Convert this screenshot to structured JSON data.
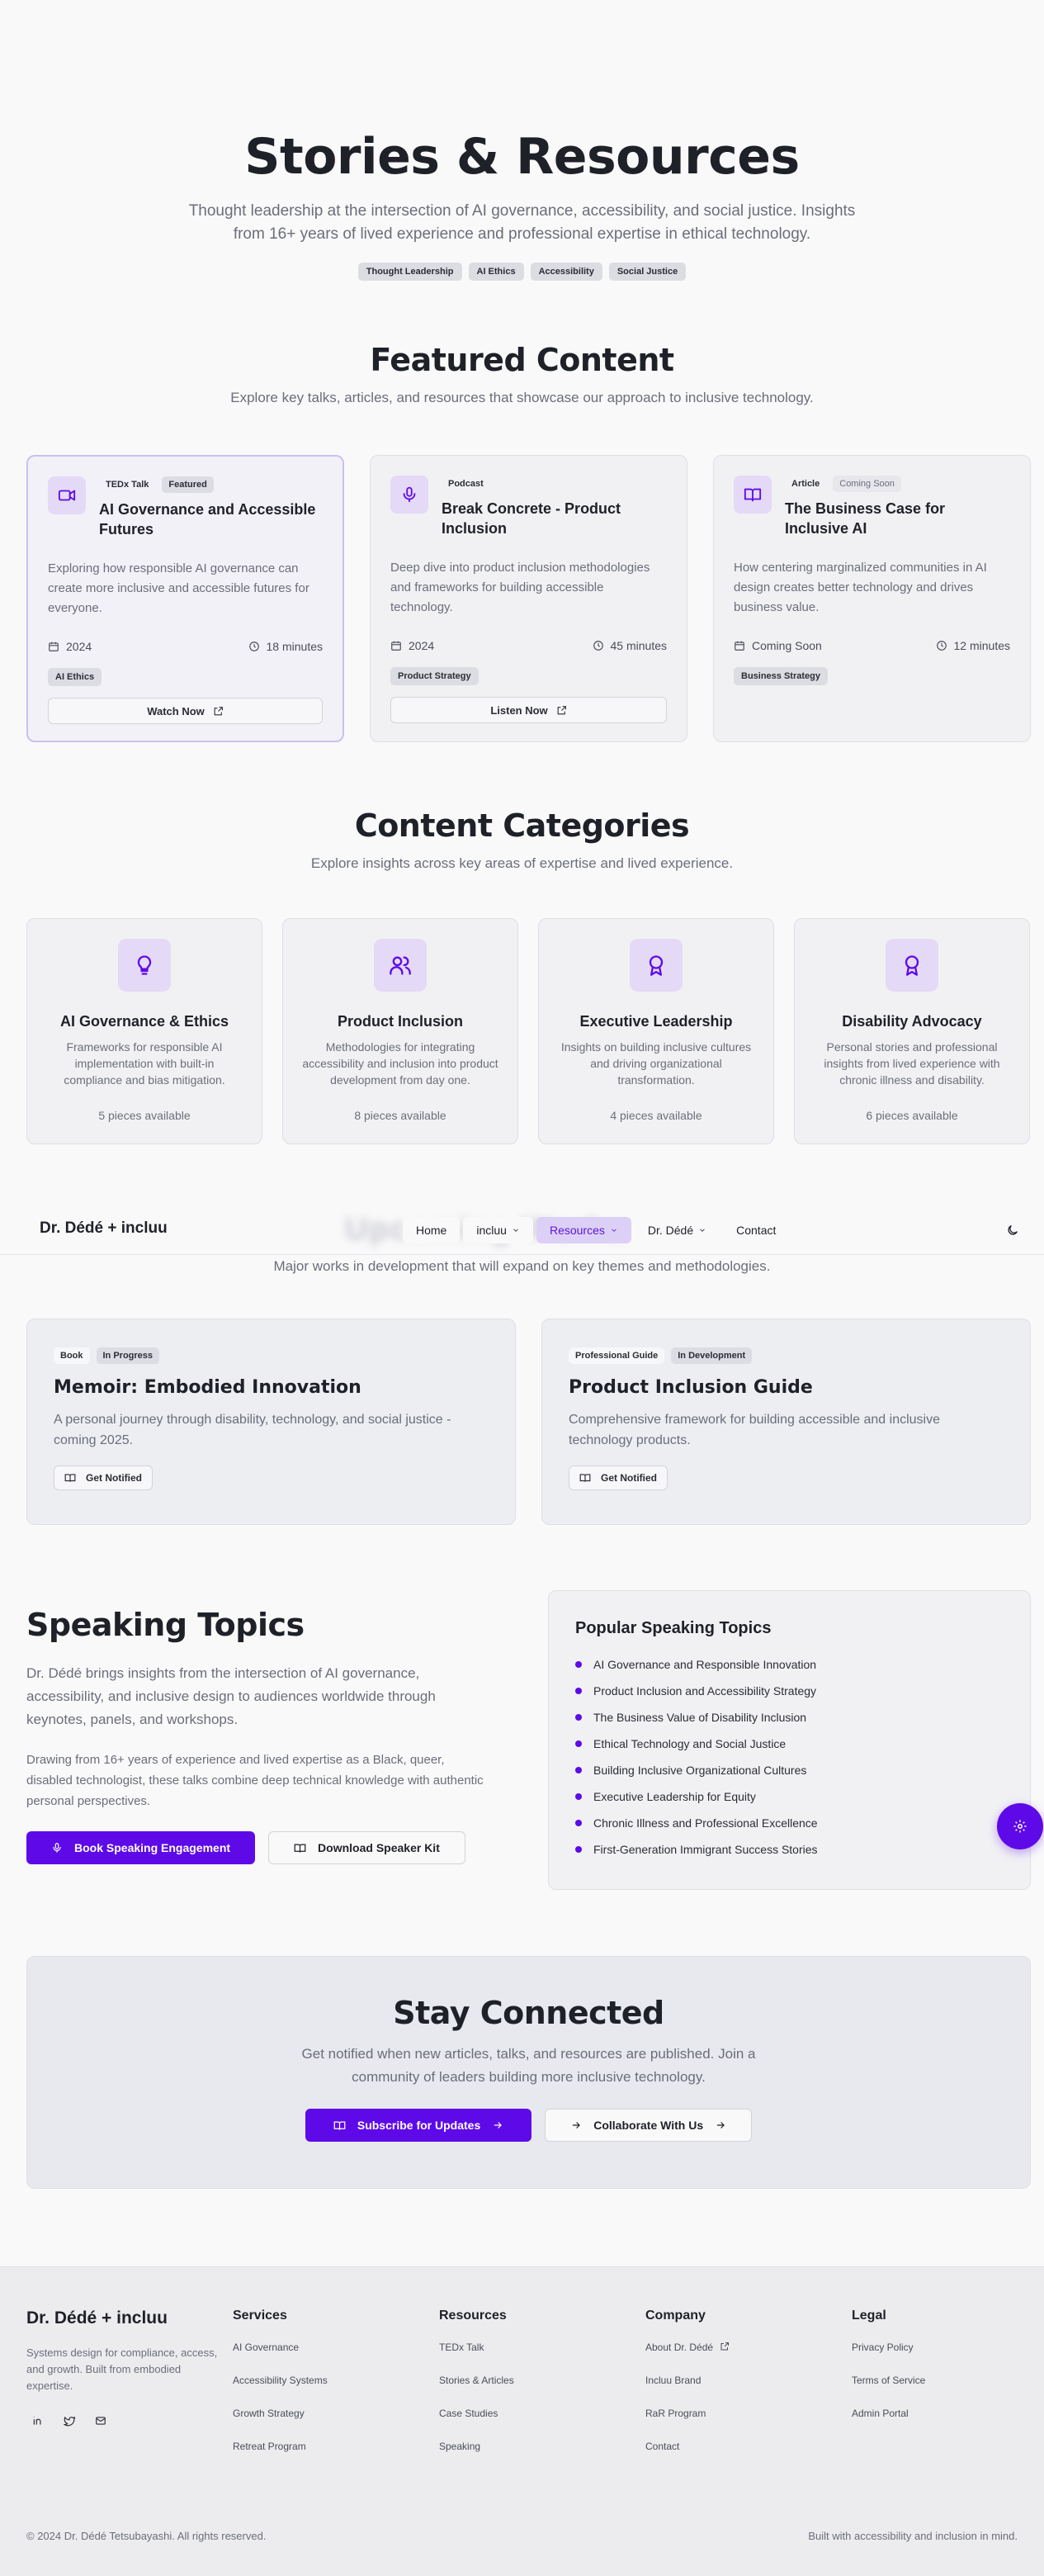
{
  "hero": {
    "title": "Stories & Resources",
    "subtitle": "Thought leadership at the intersection of AI governance, accessibility, and social justice. Insights from 16+ years of lived experience and professional expertise in ethical technology.",
    "tags": [
      "Thought Leadership",
      "AI Ethics",
      "Accessibility",
      "Social Justice"
    ]
  },
  "featured": {
    "title": "Featured Content",
    "subtitle": "Explore key talks, articles, and resources that showcase our approach to inclusive technology.",
    "cards": [
      {
        "icon": "video-icon",
        "type": "TEDx Talk",
        "badge": "Featured",
        "title": "AI Governance and Accessible Futures",
        "desc": "Exploring how responsible AI governance can create more inclusive and accessible futures for everyone.",
        "date": "2024",
        "duration": "18 minutes",
        "tag": "AI Ethics",
        "action": "Watch Now"
      },
      {
        "icon": "microphone-icon",
        "type": "Podcast",
        "badge": "",
        "title": "Break Concrete - Product Inclusion",
        "desc": "Deep dive into product inclusion methodologies and frameworks for building accessible technology.",
        "date": "2024",
        "duration": "45 minutes",
        "tag": "Product Strategy",
        "action": "Listen Now"
      },
      {
        "icon": "book-open-icon",
        "type": "Article",
        "badge": "Coming Soon",
        "title": "The Business Case for Inclusive AI",
        "desc": "How centering marginalized communities in AI design creates better technology and drives business value.",
        "date": "Coming Soon",
        "duration": "12 minutes",
        "tag": "Business Strategy",
        "action": ""
      }
    ]
  },
  "categories": {
    "title": "Content Categories",
    "subtitle": "Explore insights across key areas of expertise and lived experience.",
    "items": [
      {
        "icon": "lightbulb-icon",
        "title": "AI Governance & Ethics",
        "desc": "Frameworks for responsible AI implementation with built-in compliance and bias mitigation.",
        "count": "5 pieces available"
      },
      {
        "icon": "users-icon",
        "title": "Product Inclusion",
        "desc": "Methodologies for integrating accessibility and inclusion into product development from day one.",
        "count": "8 pieces available"
      },
      {
        "icon": "award-icon",
        "title": "Executive Leadership",
        "desc": "Insights on building inclusive cultures and driving organizational transformation.",
        "count": "4 pieces available"
      },
      {
        "icon": "award-icon",
        "title": "Disability Advocacy",
        "desc": "Personal stories and professional insights from lived experience with chronic illness and disability.",
        "count": "6 pieces available"
      }
    ]
  },
  "nav": {
    "brand": "Dr. Dédé + incluu",
    "links": [
      "Home",
      "incluu",
      "Resources",
      "Dr. Dédé",
      "Contact"
    ],
    "active": "Resources"
  },
  "wip": {
    "subtitle": "Major works in development that will expand on key themes and methodologies.",
    "cards": [
      {
        "type": "Book",
        "status": "In Progress",
        "title": "Memoir: Embodied Innovation",
        "desc": "A personal journey through disability, technology, and social justice - coming 2025.",
        "action": "Get Notified"
      },
      {
        "type": "Professional Guide",
        "status": "In Development",
        "title": "Product Inclusion Guide",
        "desc": "Comprehensive framework for building accessible and inclusive technology products.",
        "action": "Get Notified"
      }
    ]
  },
  "speaking": {
    "title": "Speaking Topics",
    "p1": "Dr. Dédé brings insights from the intersection of AI governance, accessibility, and inclusive design to audiences worldwide through keynotes, panels, and workshops.",
    "p2": "Drawing from 16+ years of experience and lived expertise as a Black, queer, disabled technologist, these talks combine deep technical knowledge with authentic personal perspectives.",
    "primary": "Book Speaking Engagement",
    "secondary": "Download Speaker Kit",
    "popular_title": "Popular Speaking Topics",
    "topics": [
      "AI Governance and Responsible Innovation",
      "Product Inclusion and Accessibility Strategy",
      "The Business Value of Disability Inclusion",
      "Ethical Technology and Social Justice",
      "Building Inclusive Organizational Cultures",
      "Executive Leadership for Equity",
      "Chronic Illness and Professional Excellence",
      "First-Generation Immigrant Success Stories"
    ]
  },
  "stay": {
    "title": "Stay Connected",
    "desc": "Get notified when new articles, talks, and resources are published. Join a community of leaders building more inclusive technology.",
    "primary": "Subscribe for Updates",
    "secondary": "Collaborate With Us"
  },
  "footer": {
    "brand": "Dr. Dédé + incluu",
    "tagline": "Systems design for compliance, access, and growth. Built from embodied expertise.",
    "columns": [
      {
        "title": "Services",
        "items": [
          "AI Governance",
          "Accessibility Systems",
          "Growth Strategy",
          "Retreat Program"
        ]
      },
      {
        "title": "Resources",
        "items": [
          "TEDx Talk",
          "Stories & Articles",
          "Case Studies",
          "Speaking"
        ]
      },
      {
        "title": "Company",
        "items": [
          "About Dr. Dédé",
          "Incluu Brand",
          "RaR Program",
          "Contact"
        ]
      },
      {
        "title": "Legal",
        "items": [
          "Privacy Policy",
          "Terms of Service",
          "Admin Portal"
        ]
      }
    ],
    "copyright": "© 2024 Dr. Dédé Tetsubayashi. All rights reserved.",
    "built": "Built with accessibility and inclusion in mind."
  },
  "colors": {
    "accent": "#5e0ae8",
    "accent_soft": "#e4d9f6",
    "text": "#1f2128",
    "muted": "#6b6e7a"
  }
}
